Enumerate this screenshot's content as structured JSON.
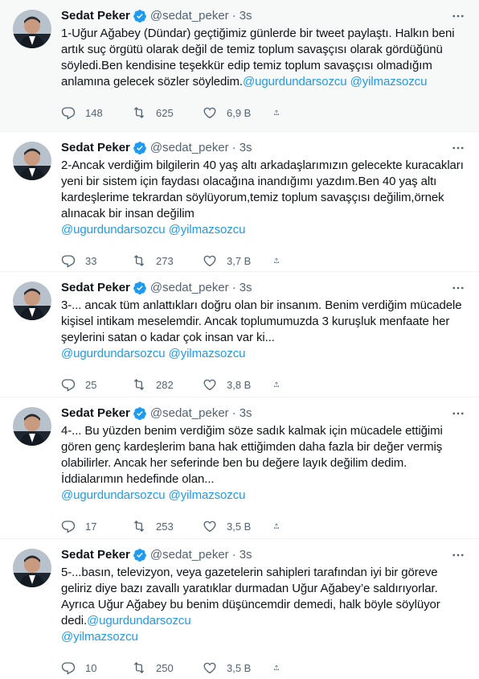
{
  "tweets": [
    {
      "name": "Sedat Peker",
      "handle": "@sedat_peker",
      "dot": "·",
      "time": "3s",
      "text": "1-Uğur Ağabey (Dündar) geçtiğimiz günlerde bir tweet paylaştı. Halkın beni artık suç örgütü olarak değil de temiz toplum savaşçısı olarak gördüğünü söyledi.Ben kendisine teşekkür edip temiz toplum savaşçısı olmadığım anlamına gelecek sözler söyledim.",
      "mentions": [
        "@ugurdundarsozcu",
        "@yilmazsozcu"
      ],
      "replies": "148",
      "retweets": "625",
      "likes": "6,9 B"
    },
    {
      "name": "Sedat Peker",
      "handle": "@sedat_peker",
      "dot": "·",
      "time": "3s",
      "text": "2-Ancak verdiğim bilgilerin 40 yaş altı arkadaşlarımızın gelecekte kuracakları yeni bir sistem için faydası olacağına inandığımı yazdım.Ben 40 yaş altı kardeşlerime tekrardan söylüyorum,temiz toplum savaşçısı değilim,örnek alınacak bir insan değilim",
      "mentions": [
        "@ugurdundarsozcu",
        "@yilmazsozcu"
      ],
      "replies": "33",
      "retweets": "273",
      "likes": "3,7 B"
    },
    {
      "name": "Sedat Peker",
      "handle": "@sedat_peker",
      "dot": "·",
      "time": "3s",
      "text": "3-... ancak tüm anlattıkları doğru olan bir insanım. Benim verdiğim mücadele kişisel intikam meselemdir. Ancak toplumumuzda 3 kuruşluk menfaate her şeylerini satan o kadar çok insan var ki...",
      "mentions": [
        "@ugurdundarsozcu",
        "@yilmazsozcu"
      ],
      "replies": "25",
      "retweets": "282",
      "likes": "3,8 B"
    },
    {
      "name": "Sedat Peker",
      "handle": "@sedat_peker",
      "dot": "·",
      "time": "3s",
      "text": "4-... Bu yüzden benim verdiğim söze sadık kalmak için mücadele ettiğimi gören genç kardeşlerim bana hak ettiğimden daha fazla bir değer vermiş olabilirler. Ancak her seferinde ben bu değere layık değilim dedim. İddialarımın hedefinde olan...",
      "mentions": [
        "@ugurdundarsozcu",
        "@yilmazsozcu"
      ],
      "replies": "17",
      "retweets": "253",
      "likes": "3,5 B"
    },
    {
      "name": "Sedat Peker",
      "handle": "@sedat_peker",
      "dot": "·",
      "time": "3s",
      "text": "5-...basın, televizyon, veya gazetelerin sahipleri tarafından iyi bir göreve geliriz diye bazı zavallı yaratıklar durmadan Uğur Ağabey’e saldırıyorlar. Ayrıca Uğur Ağabey bu benim düşüncemdir demedi, halk böyle söylüyor dedi.",
      "mentions": [
        "@ugurdundarsozcu",
        "@yilmazsozcu"
      ],
      "replies": "10",
      "retweets": "250",
      "likes": "3,5 B"
    }
  ],
  "colors": {
    "accent": "#1d9bf0",
    "muted": "#536471",
    "text": "#0f1419",
    "highlight_bg": "#f7f9f9"
  },
  "icons": [
    "verified-badge-icon",
    "more-dots-icon",
    "reply-icon",
    "retweet-icon",
    "like-icon",
    "share-icon"
  ]
}
